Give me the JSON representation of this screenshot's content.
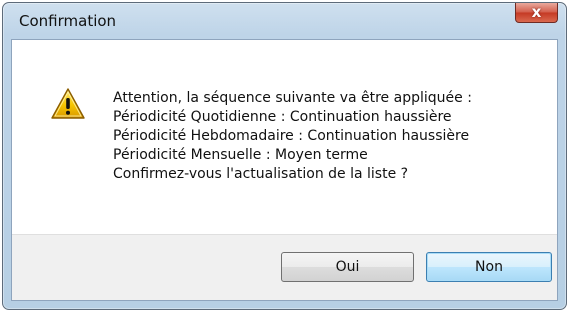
{
  "window": {
    "title": "Confirmation",
    "close_label": "x"
  },
  "dialog": {
    "icon": "warning-icon",
    "message_lines": [
      "Attention, la séquence suivante va être appliquée :",
      "Périodicité Quotidienne : Continuation haussière",
      "Périodicité Hebdomadaire : Continuation haussière",
      "Périodicité Mensuelle : Moyen terme",
      "Confirmez-vous l'actualisation de la liste ?"
    ]
  },
  "buttons": {
    "yes_label": "Oui",
    "no_label": "Non"
  },
  "colors": {
    "window_frame": "#bed4e8",
    "close_button": "#c53a24",
    "default_button": "#bee6fd"
  }
}
